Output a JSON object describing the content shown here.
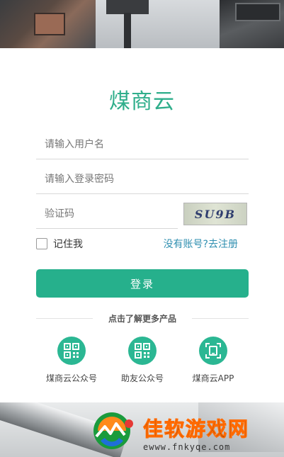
{
  "brand": {
    "name": "煤商云"
  },
  "form": {
    "username_placeholder": "请输入用户名",
    "password_placeholder": "请输入登录密码",
    "captcha_placeholder": "验证码",
    "captcha_text": "SU9B",
    "remember_label": "记住我",
    "register_link": "没有账号?去注册",
    "login_button": "登录"
  },
  "more": {
    "title": "点击了解更多产品",
    "items": [
      {
        "label": "煤商云公众号",
        "icon": "qr-code-icon"
      },
      {
        "label": "助友公众号",
        "icon": "qr-code-icon"
      },
      {
        "label": "煤商云APP",
        "icon": "scan-app-icon"
      }
    ]
  },
  "watermark": {
    "title": "佳软游戏网",
    "url": "ewww.fnkyqe.com"
  },
  "colors": {
    "brand": "#2fae8b",
    "button": "#26b08c",
    "link": "#2f8fb0",
    "icon_bg": "#2bb793"
  }
}
